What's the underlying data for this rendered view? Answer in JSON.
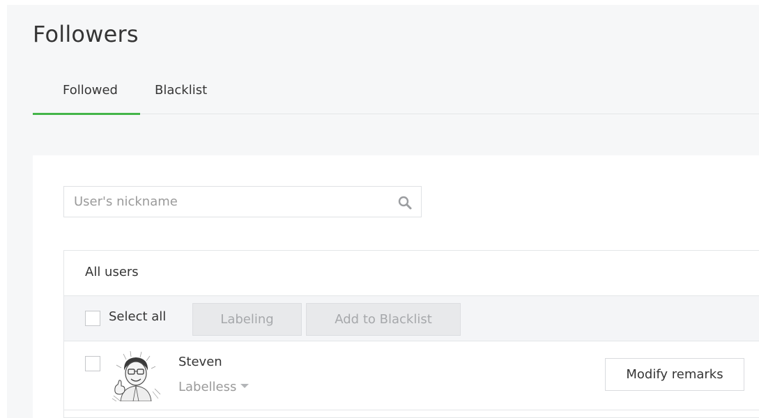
{
  "page": {
    "title": "Followers"
  },
  "tabs": [
    {
      "label": "Followed",
      "active": true
    },
    {
      "label": "Blacklist",
      "active": false
    }
  ],
  "search": {
    "placeholder": "User's nickname",
    "value": "",
    "icon": "search-icon"
  },
  "table": {
    "header": "All users",
    "toolbar": {
      "select_all_label": "Select all",
      "labeling_label": "Labeling",
      "add_blacklist_label": "Add to Blacklist"
    },
    "rows": [
      {
        "name": "Steven",
        "label": "Labelless",
        "action_label": "Modify remarks",
        "avatar": "cartoon-caricature-avatar"
      }
    ]
  },
  "colors": {
    "accent": "#44b549",
    "background": "#f6f7f8",
    "panel": "#ffffff",
    "disabled_text": "#a6a8ab",
    "muted_text": "#9a9a9a"
  }
}
